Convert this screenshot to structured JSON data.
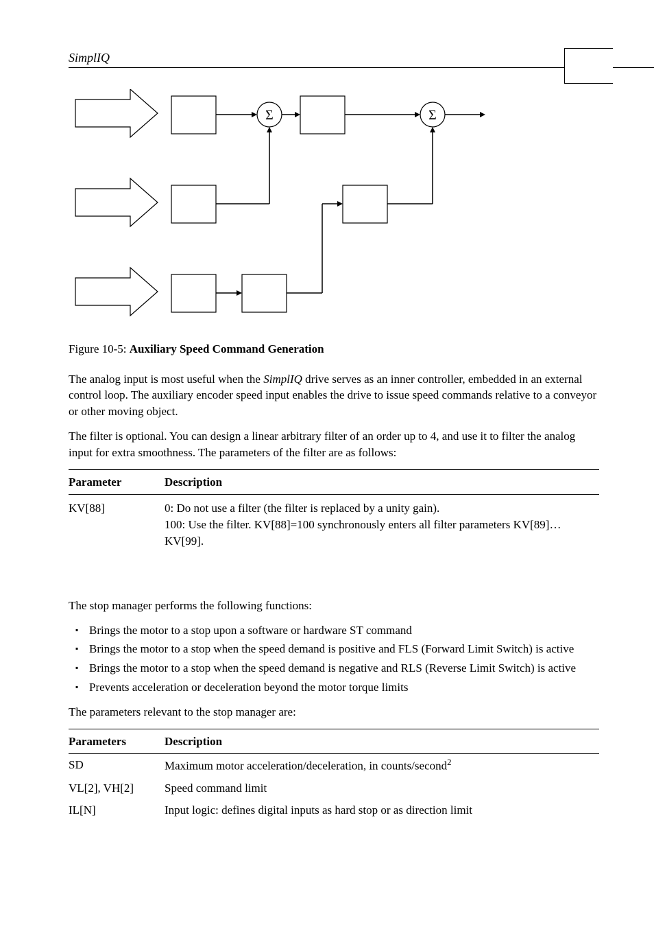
{
  "header": {
    "title": "SimplIQ"
  },
  "diagram": {
    "sigma1": "Σ",
    "sigma2": "Σ"
  },
  "figure_caption": {
    "prefix": "Figure 10-5: ",
    "title": "Auxiliary Speed Command Generation"
  },
  "para1_a": "The analog input is most useful when the ",
  "para1_brand": "SimplIQ",
  "para1_b": " drive serves as an inner controller, embedded in an external control loop. The auxiliary encoder speed input enables the drive to issue speed commands relative to a conveyor or other moving object.",
  "para2": "The filter is optional. You can design a linear arbitrary filter of an order up to 4, and use it to filter the analog input for extra smoothness. The parameters of the filter are as follows:",
  "table1": {
    "headers": {
      "param": "Parameter",
      "desc": "Description"
    },
    "rows": [
      {
        "param": "KV[88]",
        "desc": "0: Do not use a filter (the filter is replaced by a unity gain).\n100: Use the filter. KV[88]=100 synchronously enters all filter parameters KV[89]…KV[99]."
      }
    ]
  },
  "stop_intro": "The stop manager performs the following functions:",
  "bullets": [
    "Brings the motor to a stop upon a software or hardware ST command",
    "Brings the motor to a stop when the speed demand is positive and FLS (Forward Limit Switch) is active",
    "Brings the motor to a stop when the speed demand is negative and RLS (Reverse Limit Switch) is active",
    "Prevents acceleration or deceleration beyond the motor torque limits"
  ],
  "stop_params_intro": "The parameters relevant to the stop manager are:",
  "table2": {
    "headers": {
      "param": "Parameters",
      "desc": "Description"
    },
    "rows": [
      {
        "param": "SD",
        "desc": "Maximum motor acceleration/deceleration, in counts/second",
        "sup": "2"
      },
      {
        "param": "VL[2], VH[2]",
        "desc": "Speed command limit"
      },
      {
        "param": "IL[N]",
        "desc": "Input logic: defines digital inputs as hard stop or as direction limit"
      }
    ]
  }
}
